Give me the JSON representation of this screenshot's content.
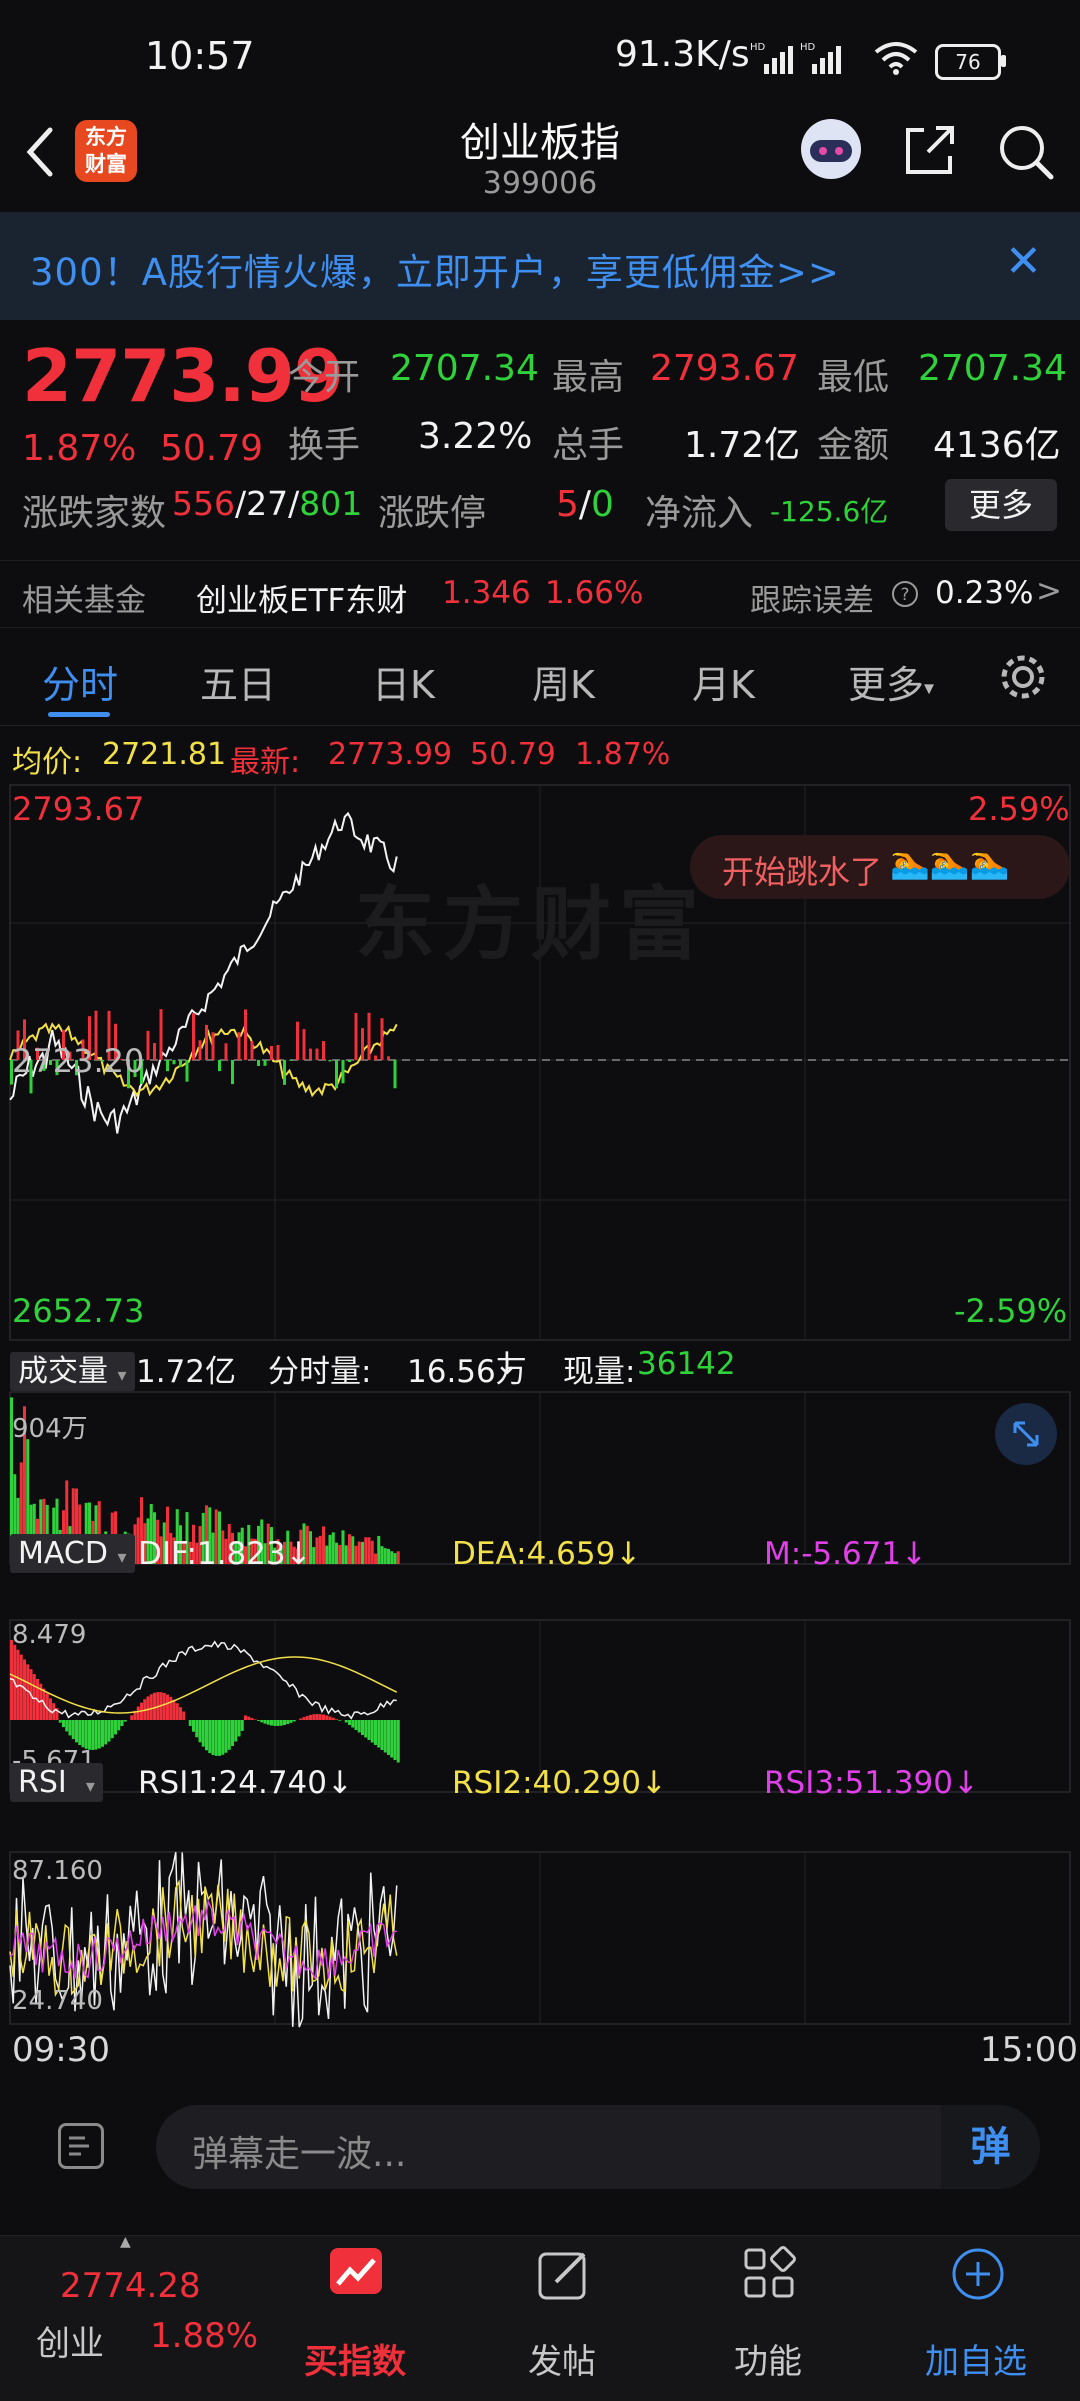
{
  "status": {
    "time": "10:57",
    "net": "91.3K/s",
    "battery": "76"
  },
  "header": {
    "title": "创业板指",
    "code": "399006",
    "logo_line1": "东方",
    "logo_line2": "财富"
  },
  "banner": {
    "text": "300！A股行情火爆，立即开户，享更低佣金>>",
    "close": "✕"
  },
  "quote": {
    "price": "2773.99",
    "pct": "1.87%",
    "chg": "50.79",
    "open_label": "今开",
    "open": "2707.34",
    "high_label": "最高",
    "high": "2793.67",
    "low_label": "最低",
    "low": "2707.34",
    "turnover_label": "换手",
    "turnover": "3.22%",
    "volume_label": "总手",
    "volume": "1.72亿",
    "amount_label": "金额",
    "amount": "4136亿",
    "breadth_label": "涨跌家数",
    "breadth_up": "556",
    "breadth_flat": "27",
    "breadth_down": "801",
    "limit_label": "涨跌停",
    "limit_up": "5",
    "limit_down": "0",
    "netflow_label": "净流入",
    "netflow": "-125.6亿",
    "more": "更多"
  },
  "fund": {
    "label": "相关基金",
    "name": "创业板ETF东财",
    "price": "1.346",
    "pct": "1.66%",
    "tracking_label": "跟踪误差",
    "tracking": "0.23%",
    "chevron": ">"
  },
  "tabs": [
    "分时",
    "五日",
    "日K",
    "周K",
    "月K",
    "更多"
  ],
  "legend": {
    "avg_label": "均价:",
    "avg": "2721.81",
    "last_label": "最新:",
    "last": "2773.99",
    "chg": "50.79",
    "pct": "1.87%"
  },
  "price_axis": {
    "top": "2793.67",
    "mid": "2723.20",
    "bottom": "2652.73",
    "top_pct": "2.59%",
    "bottom_pct": "-2.59%"
  },
  "bubble": {
    "text": "开始跳水了",
    "emoji": "🏊🏊🏊"
  },
  "watermark": "东方财富",
  "volume_panel": {
    "label": "成交量",
    "total": "1.72亿",
    "tick_label": "分时量:",
    "tick": "16.56万",
    "tick_arrow": "↓",
    "now_label": "现量:",
    "now": "36142",
    "max": "904万"
  },
  "macd_panel": {
    "label": "MACD",
    "dif": "DIF:1.823",
    "dea": "DEA:4.659",
    "m": "M:-5.671",
    "arrow": "↓",
    "max": "8.479",
    "min": "-5.671"
  },
  "rsi_panel": {
    "label": "RSI",
    "rsi1": "RSI1:24.740",
    "rsi2": "RSI2:40.290",
    "rsi3": "RSI3:51.390",
    "arrow": "↓",
    "max": "87.160",
    "min": "24.740"
  },
  "time_axis": {
    "start": "09:30",
    "end": "15:00"
  },
  "comment": {
    "placeholder": "弹幕走一波...",
    "dan": "弹"
  },
  "bottom_nav": {
    "index_price": "2774.28",
    "index_name": "创业",
    "index_pct": "1.88%",
    "items": [
      {
        "label": "买指数"
      },
      {
        "label": "发帖"
      },
      {
        "label": "功能"
      },
      {
        "label": "加自选"
      }
    ]
  },
  "colors": {
    "up": "#f0303a",
    "down": "#2fd23a",
    "accent": "#3f8ff0",
    "bg": "#0d0d0f"
  }
}
